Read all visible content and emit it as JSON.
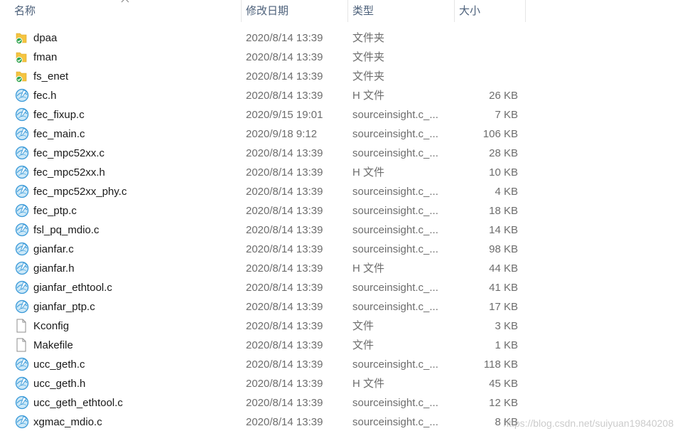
{
  "columns": {
    "name": "名称",
    "date": "修改日期",
    "type": "类型",
    "size": "大小"
  },
  "colors": {
    "header_text": "#4c607a",
    "name_text": "#1a1a1a",
    "meta_text": "#6d6d6d",
    "folder": "#f4c441",
    "sync_badge": "#2ea44f",
    "source_globe": "#3a9ad9"
  },
  "files": [
    {
      "name": "dpaa",
      "date": "2020/8/14 13:39",
      "type": "文件夹",
      "size": "",
      "icon": "folder-synced-icon"
    },
    {
      "name": "fman",
      "date": "2020/8/14 13:39",
      "type": "文件夹",
      "size": "",
      "icon": "folder-synced-icon"
    },
    {
      "name": "fs_enet",
      "date": "2020/8/14 13:39",
      "type": "文件夹",
      "size": "",
      "icon": "folder-synced-icon"
    },
    {
      "name": "fec.h",
      "date": "2020/8/14 13:39",
      "type": "H 文件",
      "size": "26 KB",
      "icon": "source-file-icon"
    },
    {
      "name": "fec_fixup.c",
      "date": "2020/9/15 19:01",
      "type": "sourceinsight.c_...",
      "size": "7 KB",
      "icon": "source-file-icon"
    },
    {
      "name": "fec_main.c",
      "date": "2020/9/18 9:12",
      "type": "sourceinsight.c_...",
      "size": "106 KB",
      "icon": "source-file-icon"
    },
    {
      "name": "fec_mpc52xx.c",
      "date": "2020/8/14 13:39",
      "type": "sourceinsight.c_...",
      "size": "28 KB",
      "icon": "source-file-icon"
    },
    {
      "name": "fec_mpc52xx.h",
      "date": "2020/8/14 13:39",
      "type": "H 文件",
      "size": "10 KB",
      "icon": "source-file-icon"
    },
    {
      "name": "fec_mpc52xx_phy.c",
      "date": "2020/8/14 13:39",
      "type": "sourceinsight.c_...",
      "size": "4 KB",
      "icon": "source-file-icon"
    },
    {
      "name": "fec_ptp.c",
      "date": "2020/8/14 13:39",
      "type": "sourceinsight.c_...",
      "size": "18 KB",
      "icon": "source-file-icon"
    },
    {
      "name": "fsl_pq_mdio.c",
      "date": "2020/8/14 13:39",
      "type": "sourceinsight.c_...",
      "size": "14 KB",
      "icon": "source-file-icon"
    },
    {
      "name": "gianfar.c",
      "date": "2020/8/14 13:39",
      "type": "sourceinsight.c_...",
      "size": "98 KB",
      "icon": "source-file-icon"
    },
    {
      "name": "gianfar.h",
      "date": "2020/8/14 13:39",
      "type": "H 文件",
      "size": "44 KB",
      "icon": "source-file-icon"
    },
    {
      "name": "gianfar_ethtool.c",
      "date": "2020/8/14 13:39",
      "type": "sourceinsight.c_...",
      "size": "41 KB",
      "icon": "source-file-icon"
    },
    {
      "name": "gianfar_ptp.c",
      "date": "2020/8/14 13:39",
      "type": "sourceinsight.c_...",
      "size": "17 KB",
      "icon": "source-file-icon"
    },
    {
      "name": "Kconfig",
      "date": "2020/8/14 13:39",
      "type": "文件",
      "size": "3 KB",
      "icon": "blank-file-icon"
    },
    {
      "name": "Makefile",
      "date": "2020/8/14 13:39",
      "type": "文件",
      "size": "1 KB",
      "icon": "blank-file-icon"
    },
    {
      "name": "ucc_geth.c",
      "date": "2020/8/14 13:39",
      "type": "sourceinsight.c_...",
      "size": "118 KB",
      "icon": "source-file-icon"
    },
    {
      "name": "ucc_geth.h",
      "date": "2020/8/14 13:39",
      "type": "H 文件",
      "size": "45 KB",
      "icon": "source-file-icon"
    },
    {
      "name": "ucc_geth_ethtool.c",
      "date": "2020/8/14 13:39",
      "type": "sourceinsight.c_...",
      "size": "12 KB",
      "icon": "source-file-icon"
    },
    {
      "name": "xgmac_mdio.c",
      "date": "2020/8/14 13:39",
      "type": "sourceinsight.c_...",
      "size": "8 KB",
      "icon": "source-file-icon"
    }
  ],
  "watermark": "https://blog.csdn.net/suiyuan19840208"
}
